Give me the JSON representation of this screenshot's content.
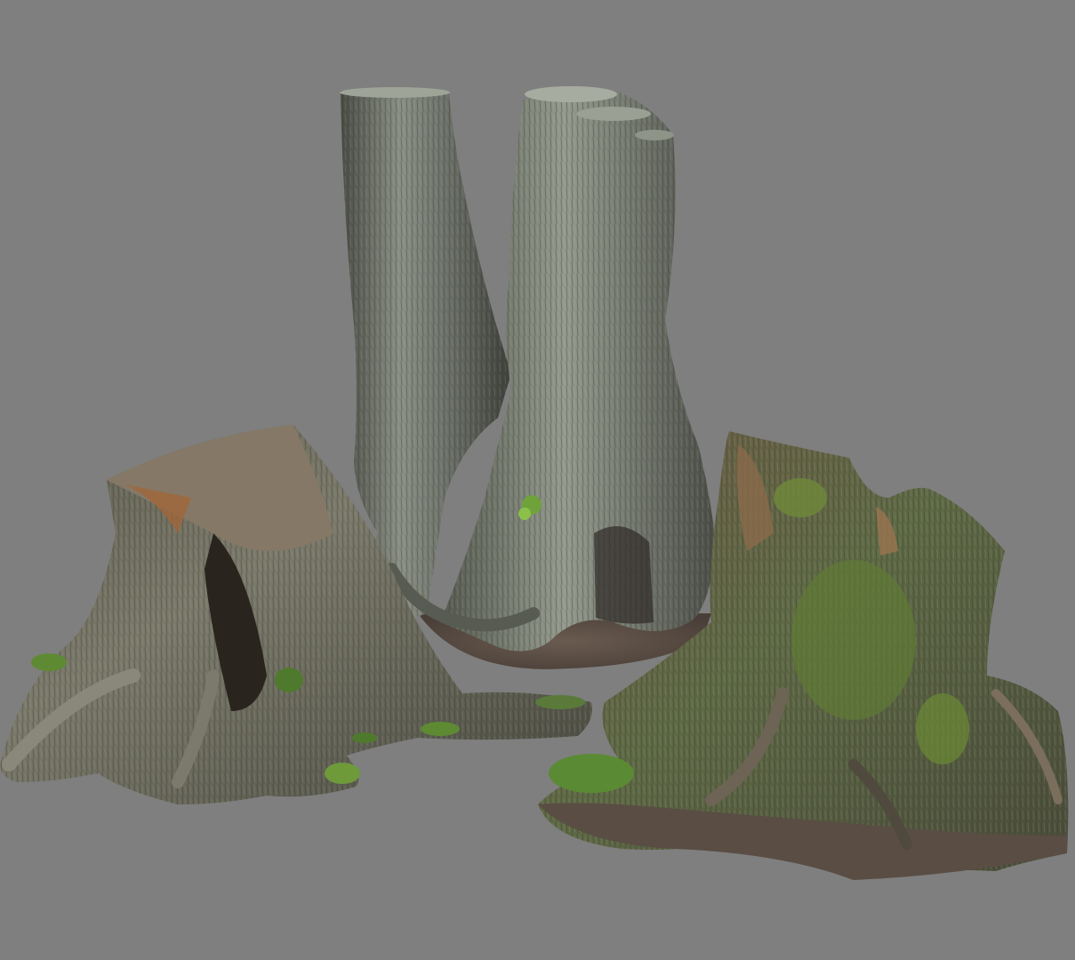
{
  "scene": {
    "subject": "tree-stumps",
    "background_color": "#7f7f7f",
    "colors": {
      "bark_light": "#8d9286",
      "bark_mid": "#6c7068",
      "bark_dark": "#3b3d36",
      "wood_warm": "#7a6247",
      "moss": "#5f7a34",
      "moss_bright": "#7fa83a",
      "ground": "#5d5047"
    }
  }
}
